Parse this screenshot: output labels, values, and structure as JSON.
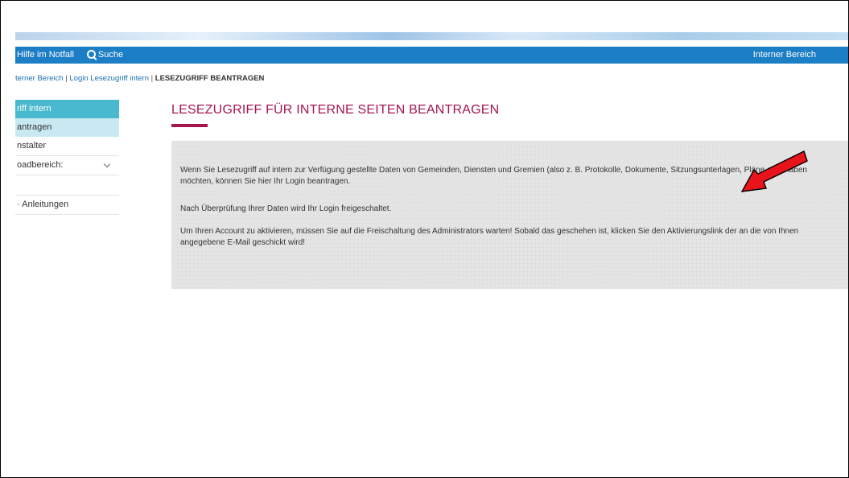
{
  "topbar": {
    "emergency_help": "Hilfe im Notfall",
    "search": "Suche",
    "internal_area": "Interner Bereich"
  },
  "breadcrumb": {
    "item1": "terner Bereich",
    "sep1": " | ",
    "item2": "Login Lesezugriff intern",
    "sep2": " | ",
    "current": "LESEZUGRIFF BEANTRAGEN"
  },
  "sidebar": {
    "items": [
      {
        "label": "riff intern"
      },
      {
        "label": "antragen"
      },
      {
        "label": "nstalter"
      },
      {
        "label": "oadbereich:"
      },
      {
        "label": "· Anleitungen"
      }
    ]
  },
  "main": {
    "title": "LESEZUGRIFF FÜR INTERNE SEITEN BEANTRAGEN",
    "paragraph1": "Wenn Sie Lesezugriff auf intern zur Verfügung gestellte Daten von Gemeinden, Diensten und Gremien (also z. B. Protokolle, Dokumente, Sitzungsunterlagen, Pläne etc.) haben möchten, können Sie hier Ihr Login beantragen.",
    "paragraph2": "Nach Überprüfung Ihrer Daten wird Ihr Login freigeschaltet.",
    "paragraph3": "Um Ihren Account zu aktivieren, müssen Sie auf die Freischaltung des Administrators warten! Sobald das geschehen ist, klicken Sie den Aktivierungslink der an die von Ihnen angegebene E-Mail geschickt wird!"
  },
  "colors": {
    "topbar": "#1c7ec4",
    "accent": "#a5154f",
    "sidebar_active": "#49b9cf",
    "sidebar_sub": "#c9e9f2",
    "annotation_arrow": "#e8141b"
  }
}
